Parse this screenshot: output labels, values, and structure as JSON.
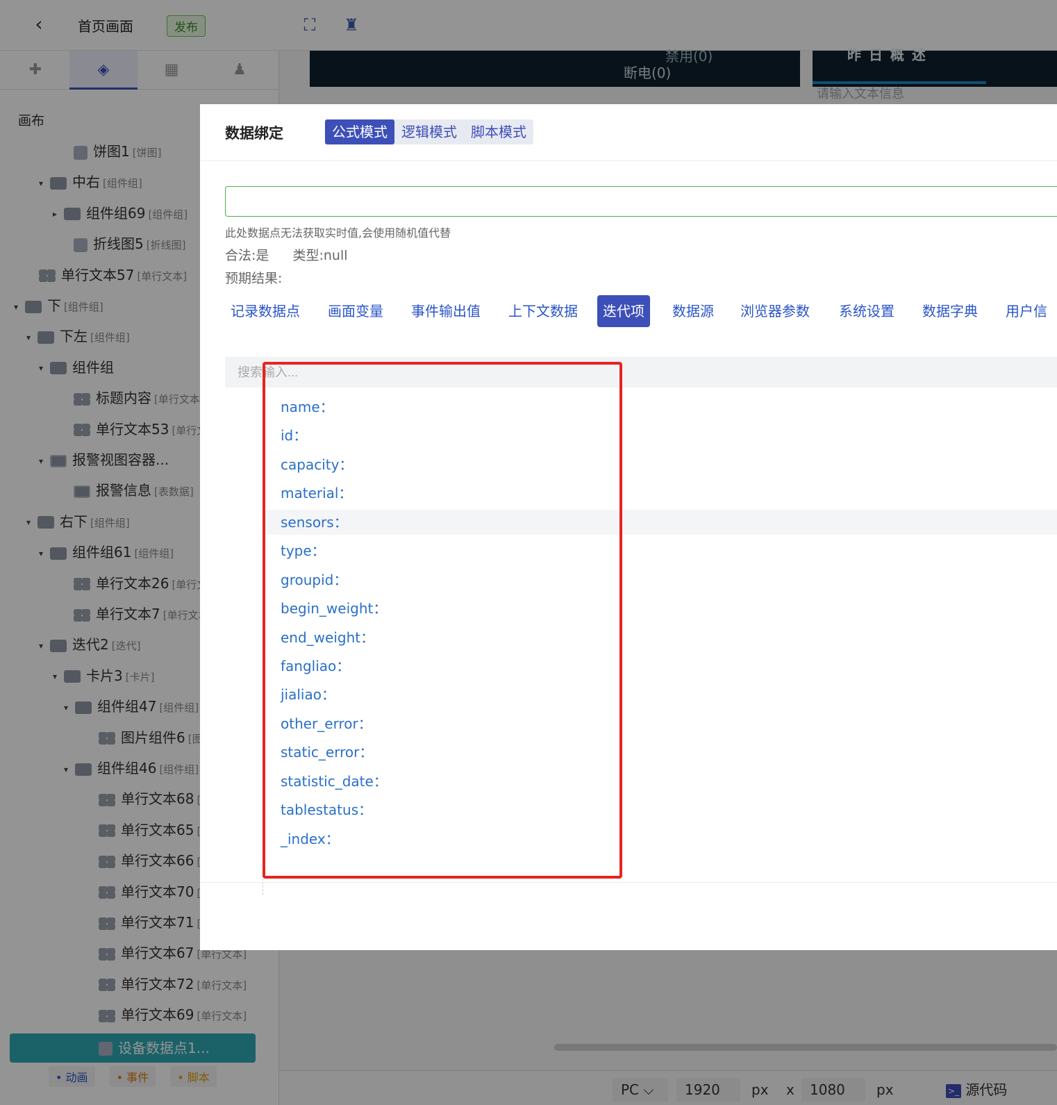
{
  "topbar": {
    "back_glyph": "‹",
    "title": "首页画面",
    "publish": "发布"
  },
  "left_panel": {
    "root_label": "画布",
    "tree": [
      {
        "label": "饼图1",
        "tag": "[饼图]",
        "icon": "pie-chart-icon"
      },
      {
        "label": "中右",
        "tag": "[组件组]",
        "icon": "group-icon"
      },
      {
        "label": "组件组69",
        "tag": "[组件组]",
        "icon": "group-icon"
      },
      {
        "label": "折线图5",
        "tag": "[折线图]",
        "icon": "pie-chart-icon"
      },
      {
        "label": "单行文本57",
        "tag": "[单行文本]",
        "icon": "text-widget-icon"
      },
      {
        "label": "下",
        "tag": "[组件组]",
        "icon": "group-icon"
      },
      {
        "label": "下左",
        "tag": "[组件组]",
        "icon": "group-icon"
      },
      {
        "label": "组件组",
        "tag": "",
        "icon": "group-icon"
      },
      {
        "label": "标题内容",
        "tag": "[单行文本]",
        "icon": "text-widget-icon"
      },
      {
        "label": "单行文本53",
        "tag": "[单行文本]",
        "icon": "text-widget-icon"
      },
      {
        "label": "报警视图容器...",
        "tag": "",
        "icon": "table-icon"
      },
      {
        "label": "报警信息",
        "tag": "[表数据]",
        "icon": "table-icon"
      },
      {
        "label": "右下",
        "tag": "[组件组]",
        "icon": "group-icon"
      },
      {
        "label": "组件组61",
        "tag": "[组件组]",
        "icon": "group-icon"
      },
      {
        "label": "单行文本26",
        "tag": "[单行文本]",
        "icon": "text-widget-icon"
      },
      {
        "label": "单行文本7",
        "tag": "[单行文本]",
        "icon": "text-widget-icon"
      },
      {
        "label": "迭代2",
        "tag": "[迭代]",
        "icon": "group-icon"
      },
      {
        "label": "卡片3",
        "tag": "[卡片]",
        "icon": "group-icon"
      },
      {
        "label": "组件组47",
        "tag": "[组件组]",
        "icon": "group-icon"
      },
      {
        "label": "图片组件6",
        "tag": "[图片]",
        "icon": "text-widget-icon"
      },
      {
        "label": "组件组46",
        "tag": "[组件组]",
        "icon": "group-icon"
      },
      {
        "label": "单行文本68",
        "tag": "[单行文本]",
        "icon": "text-widget-icon"
      },
      {
        "label": "单行文本65",
        "tag": "[单行文本]",
        "icon": "text-widget-icon"
      },
      {
        "label": "单行文本66",
        "tag": "[单行文本]",
        "icon": "text-widget-icon"
      },
      {
        "label": "单行文本70",
        "tag": "[单行文本]",
        "icon": "text-widget-icon"
      },
      {
        "label": "单行文本71",
        "tag": "[单行文本]",
        "icon": "text-widget-icon"
      },
      {
        "label": "单行文本67",
        "tag": "[单行文本]",
        "icon": "text-widget-icon"
      },
      {
        "label": "单行文本72",
        "tag": "[单行文本]",
        "icon": "text-widget-icon"
      },
      {
        "label": "单行文本69",
        "tag": "[单行文本]",
        "icon": "text-widget-icon"
      },
      {
        "label": "设备数据点1...",
        "tag": "",
        "icon": "pie-chart-icon"
      }
    ],
    "bottom": {
      "anim": "• 动画",
      "event": "• 事件",
      "script": "• 脚本"
    }
  },
  "canvas": {
    "text_disabled": "禁用(0)",
    "text_power_off": "断电(0)",
    "text_overview": "昨 日 概 述",
    "text_input_hint": "请输入文本信息"
  },
  "status_bar": {
    "device": "PC",
    "width": "1920",
    "unit1": "px",
    "times": "x",
    "height": "1080",
    "unit2": "px",
    "source_code": "源代码"
  },
  "modal": {
    "title": "数据绑定",
    "modes": [
      "公式模式",
      "逻辑模式",
      "脚本模式"
    ],
    "formula_value": "",
    "hint": "此处数据点无法获取实时值,会使用随机值代替",
    "legal": "合法:是",
    "type": "类型:null",
    "expected": "预期结果:",
    "source_tabs": [
      "记录数据点",
      "画面变量",
      "事件输出值",
      "上下文数据",
      "迭代项",
      "数据源",
      "浏览器参数",
      "系统设置",
      "数据字典",
      "用户信"
    ],
    "search_placeholder": "搜索输入...",
    "fields": [
      "name：",
      "id：",
      "capacity：",
      "material：",
      "sensors：",
      "type：",
      "groupid：",
      "begin_weight：",
      "end_weight：",
      "fangliao：",
      "jialiao：",
      "other_error：",
      "static_error：",
      "statistic_date：",
      "tablestatus：",
      "_index："
    ]
  },
  "colors": {
    "accent": "#3d4fb8",
    "field_text": "#2a6fc9",
    "highlight_box": "#e8231f",
    "selected_tree": "#2fa7b3"
  }
}
